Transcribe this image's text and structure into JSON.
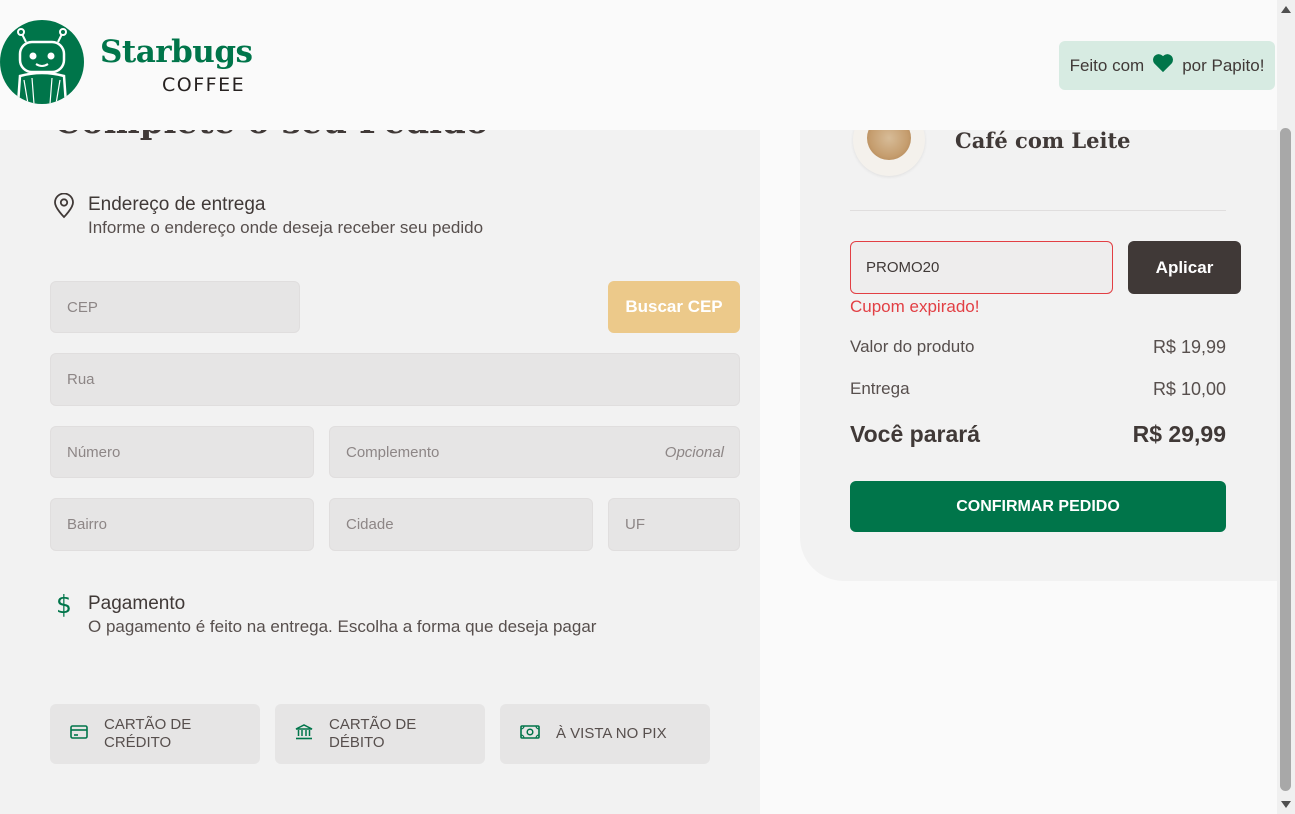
{
  "colors": {
    "brand": "#00754a",
    "accent_yellow": "#ecc98a",
    "error": "#e23f44",
    "dark": "#403937"
  },
  "header": {
    "brand_name": "Starbugs",
    "brand_sub": "COFFEE",
    "made_with_prefix": "Feito com",
    "made_with_suffix": "por Papito!",
    "heart_icon": "heart-icon"
  },
  "checkout": {
    "title": "Complete o seu Pedido",
    "address": {
      "title": "Endereço de entrega",
      "subtitle": "Informe o endereço onde deseja receber seu pedido",
      "icon": "map-pin-icon"
    },
    "fields": {
      "cep": {
        "placeholder": "CEP",
        "value": ""
      },
      "search_cep_button": "Buscar CEP",
      "rua": {
        "placeholder": "Rua",
        "value": ""
      },
      "numero": {
        "placeholder": "Número",
        "value": ""
      },
      "complemento": {
        "placeholder": "Complemento",
        "value": "",
        "optional_label": "Opcional"
      },
      "bairro": {
        "placeholder": "Bairro",
        "value": ""
      },
      "cidade": {
        "placeholder": "Cidade",
        "value": ""
      },
      "uf": {
        "placeholder": "UF",
        "value": ""
      }
    },
    "payment": {
      "title": "Pagamento",
      "subtitle": "O pagamento é feito na entrega. Escolha a forma que deseja pagar",
      "icon": "currency-dollar-icon",
      "options": [
        {
          "label_line1": "CARTÃO DE",
          "label_line2": "CRÉDITO",
          "icon": "credit-card-icon"
        },
        {
          "label_line1": "CARTÃO DE",
          "label_line2": "DÉBITO",
          "icon": "bank-icon"
        },
        {
          "label_line1": "À VISTA NO PIX",
          "label_line2": "",
          "icon": "money-icon"
        }
      ]
    }
  },
  "cart": {
    "product_name": "Café com Leite",
    "coupon": {
      "value": "PROMO20",
      "apply_label": "Aplicar",
      "error": "Cupom expirado!"
    },
    "summary": [
      {
        "label": "Valor do produto",
        "value": "R$ 19,99"
      },
      {
        "label": "Entrega",
        "value": "R$ 10,00"
      }
    ],
    "total": {
      "label": "Você parará",
      "value": "R$ 29,99"
    },
    "confirm_label": "CONFIRMAR PEDIDO"
  }
}
